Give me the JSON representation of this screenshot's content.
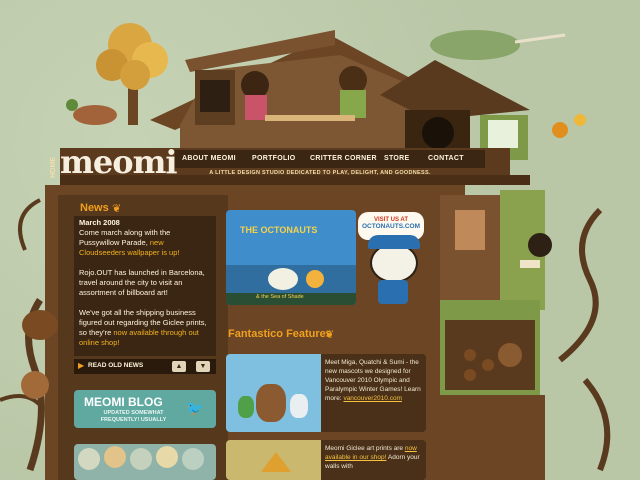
{
  "brand": {
    "home_label": "HOME",
    "logo": "meomi"
  },
  "nav": {
    "items": [
      "ABOUT MEOMI",
      "PORTFOLIO",
      "CRITTER CORNER",
      "STORE",
      "CONTACT"
    ],
    "tagline": "A LITTLE DESIGN STUDIO DEDICATED TO PLAY, DELIGHT, AND GOODNESS."
  },
  "news": {
    "title": "News",
    "date": "March 2008",
    "p1_text": "Come march along with the Pussywillow Parade,",
    "p1_link": "new Cloudseeders wallpaper is up!",
    "p2": "Rojo.OUT has launched in Barcelona, travel around the city to visit an assortment of billboard art!",
    "p3_text": "We've got all the shipping business figured out regarding the  Giclee prints, so they're",
    "p3_link": "now available through out online shop!",
    "read_old": "READ OLD NEWS"
  },
  "octonauts": {
    "banner_title": "THE OCTONAUTS",
    "banner_subtitle": "& the Sea of Shade",
    "visit_line1": "VISIT US AT",
    "visit_line2": "OCTONAUTS.COM"
  },
  "features": {
    "title": "Fantastico Features",
    "card1_text": "Meet Miga, Quatchi & Sumi - the new mascots we designed for Vancouver 2010 Olympic and Paralympic Winter Games! Learn more:",
    "card1_link": "vancouver2010.com",
    "card2_text": "Meomi Giclee art prints are",
    "card2_link": "now available in our shop!",
    "card2_more": "Adorn your walls with"
  },
  "blog": {
    "title": "MEOMI BLOG",
    "subtitle": "UPDATED SOMEWHAT FREQUENTLY! USUALLY"
  },
  "colors": {
    "background": "#b9c7a7",
    "wood_dark": "#3b2614",
    "wood_mid": "#6b4524",
    "accent_orange": "#f0a01e",
    "octonauts_blue": "#3f8ecb",
    "blog_teal": "#5fa9a1"
  },
  "icons": [
    "leaf-icon",
    "arrow-right-icon",
    "arrow-up-icon",
    "arrow-down-icon",
    "bird-icon",
    "feather-icon"
  ]
}
